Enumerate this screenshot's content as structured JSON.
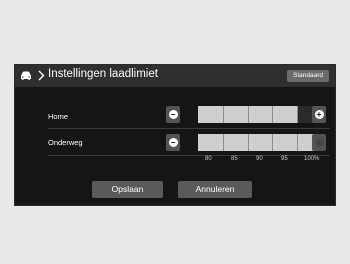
{
  "header": {
    "title": "Instellingen laadlimiet",
    "standard_label": "Standaard"
  },
  "rows": [
    {
      "label": "Home",
      "level_percent": 95
    },
    {
      "label": "Onderweg",
      "level_percent": 100
    }
  ],
  "scale": [
    "80",
    "85",
    "90",
    "95",
    "100%"
  ],
  "buttons": {
    "save": "Opslaan",
    "cancel": "Annuleren"
  },
  "icons": {
    "vehicle": "car-icon",
    "nav": "chevron-right-icon",
    "decrease": "minus-icon",
    "increase": "plus-icon"
  }
}
